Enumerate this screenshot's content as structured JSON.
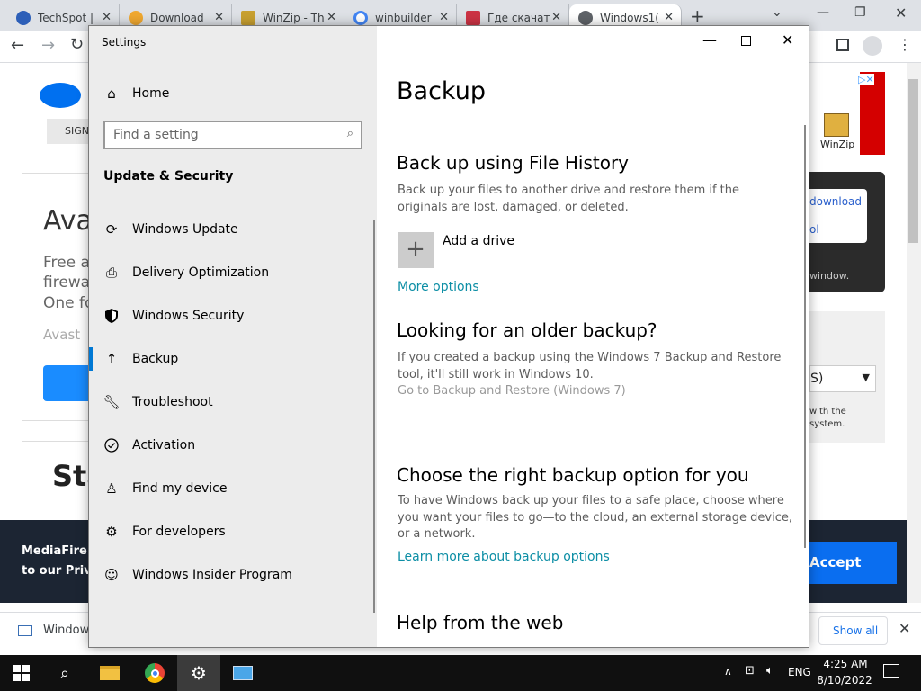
{
  "browser": {
    "tabs": [
      {
        "title": "TechSpot |",
        "color": "#2d5fb8"
      },
      {
        "title": "Download",
        "color": "#f0a830"
      },
      {
        "title": "WinZip - Th",
        "color": "#c8a030"
      },
      {
        "title": "winbuilder",
        "color": "#4285f4"
      },
      {
        "title": "Где скачат",
        "color": "#cc3344"
      },
      {
        "title": "Windows1(",
        "color": "#5f6368"
      }
    ],
    "new_tab": "+"
  },
  "background_page": {
    "signin": "SIGN",
    "heading": "Ava",
    "lines": [
      "Free a",
      "firewa",
      "One fo"
    ],
    "brand": "Avast",
    "heading2": "Sta",
    "ad_label": "WinZip",
    "download_link": "download",
    "tool_link": "ol",
    "window_note": "window.",
    "select_value": "S)",
    "with_the": "with the",
    "system": "system.",
    "cookie_text_1": "MediaFire us",
    "cookie_text_2": "to our Privac",
    "accept": "Accept"
  },
  "download_bar": {
    "item": "Windows",
    "show_all": "Show all"
  },
  "settings": {
    "window_title": "Settings",
    "home": "Home",
    "search_placeholder": "Find a setting",
    "category": "Update & Security",
    "nav": [
      {
        "label": "Windows Update",
        "icon": "sync-icon"
      },
      {
        "label": "Delivery Optimization",
        "icon": "delivery-icon"
      },
      {
        "label": "Windows Security",
        "icon": "shield-icon"
      },
      {
        "label": "Backup",
        "icon": "upload-arrow-icon",
        "selected": true
      },
      {
        "label": "Troubleshoot",
        "icon": "wrench-icon"
      },
      {
        "label": "Activation",
        "icon": "check-circle-icon"
      },
      {
        "label": "Find my device",
        "icon": "person-location-icon"
      },
      {
        "label": "For developers",
        "icon": "developer-tools-icon"
      },
      {
        "label": "Windows Insider Program",
        "icon": "insider-cat-icon"
      }
    ],
    "page_title": "Backup",
    "file_history": {
      "title": "Back up using File History",
      "desc": "Back up your files to another drive and restore them if the originals are lost, damaged, or deleted.",
      "add_drive": "Add a drive",
      "more_options": "More options"
    },
    "older_backup": {
      "title": "Looking for an older backup?",
      "desc": "If you created a backup using the Windows 7 Backup and Restore tool, it'll still work in Windows 10.",
      "link": "Go to Backup and Restore (Windows 7)"
    },
    "choose": {
      "title": "Choose the right backup option for you",
      "desc": "To have Windows back up your files to a safe place, choose where you want your files to go—to the cloud, an external storage device, or a network.",
      "link": "Learn more about backup options"
    },
    "help": {
      "title": "Help from the web"
    }
  },
  "taskbar": {
    "time": "4:25 AM",
    "date": "8/10/2022",
    "lang": "ENG"
  }
}
